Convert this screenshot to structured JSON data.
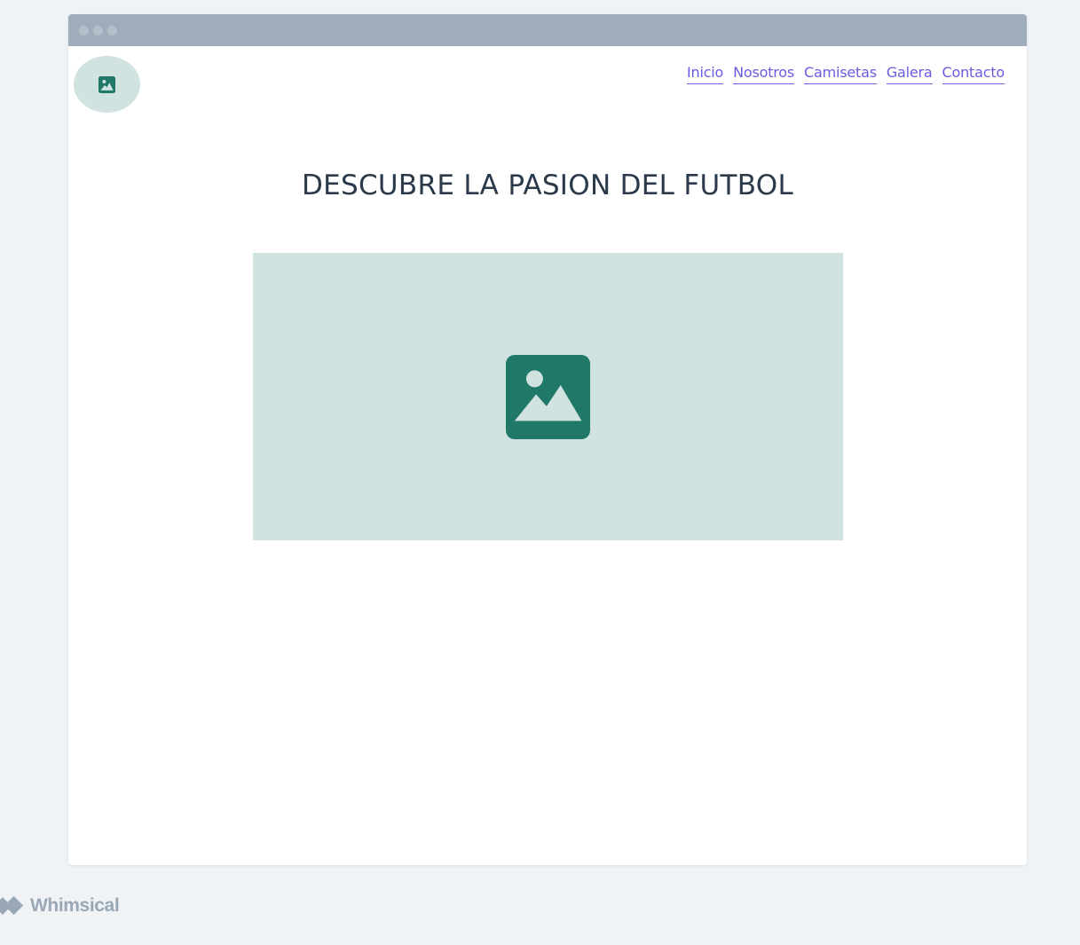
{
  "window": {
    "titlebar_dots": [
      "dot",
      "dot",
      "dot"
    ]
  },
  "header": {
    "logo_icon": "image-icon",
    "nav": [
      {
        "label": "Inicio"
      },
      {
        "label": "Nosotros"
      },
      {
        "label": "Camisetas"
      },
      {
        "label": "Galera"
      },
      {
        "label": "Contacto"
      }
    ]
  },
  "main": {
    "title": "DESCUBRE LA PASION DEL FUTBOL",
    "hero_image_icon": "image-icon"
  },
  "footer": {
    "brand": "Whimsical",
    "brand_icon": "whimsical-logo-icon"
  },
  "colors": {
    "page_background": "#eff3f6",
    "titlebar": "#9eadb9",
    "placeholder_fill": "#d1e3e1",
    "icon_green": "#1f7868",
    "link": "#6a5ce0",
    "heading": "#2a3a4a",
    "brand_gray": "#9aa8b5"
  }
}
